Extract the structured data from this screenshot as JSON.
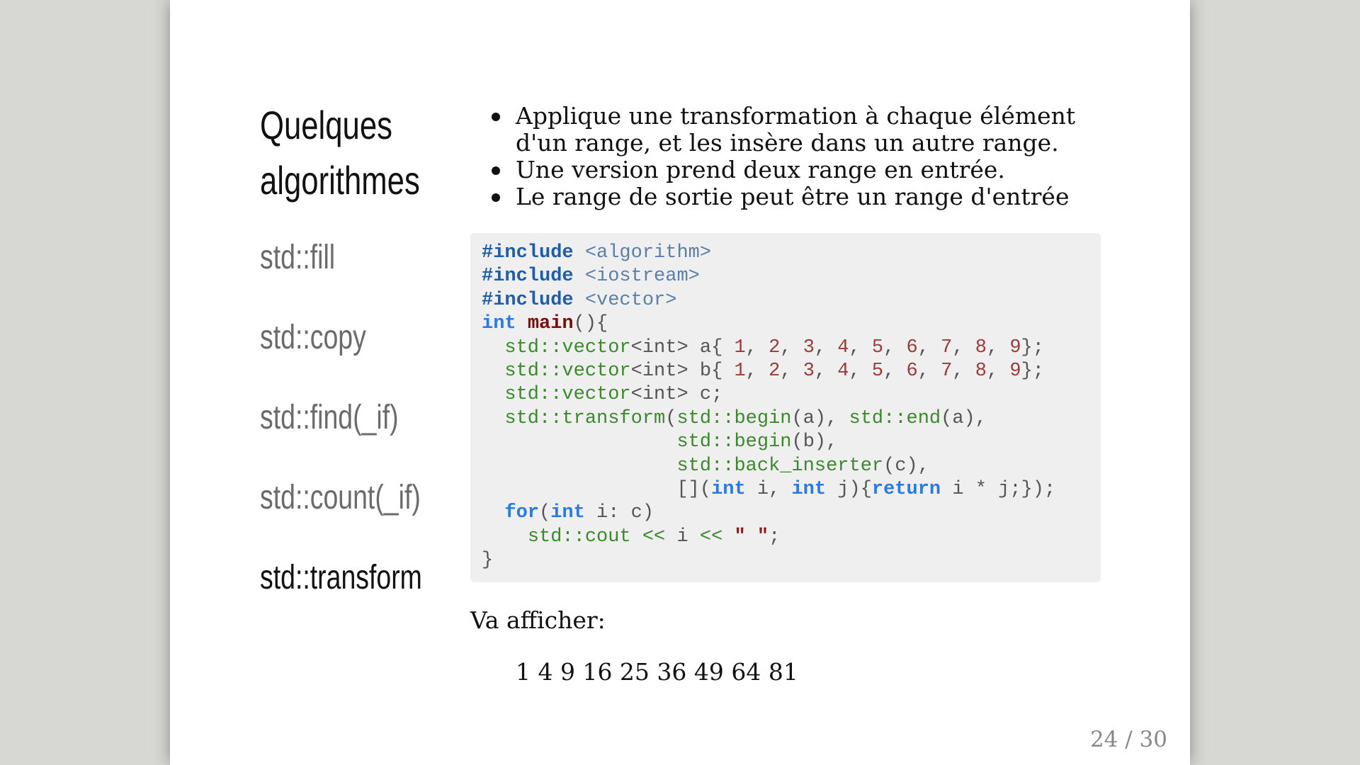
{
  "slide": {
    "title_line1": "Quelques",
    "title_line2": "algorithmes",
    "nav": [
      {
        "label": "std::fill",
        "active": false
      },
      {
        "label": "std::copy",
        "active": false
      },
      {
        "label": "std::find(_if)",
        "active": false
      },
      {
        "label": "std::count(_if)",
        "active": false
      },
      {
        "label": "std::transform",
        "active": true
      }
    ],
    "bullets": [
      "Applique une transformation à chaque élément d'un range, et les insère dans un autre range.",
      "Une version prend deux range en entrée.",
      "Le range de sortie peut être un range d'entrée"
    ],
    "code_lines": [
      "#include <algorithm>",
      "#include <iostream>",
      "#include <vector>",
      "int main(){",
      "  std::vector<int> a{ 1, 2, 3, 4, 5, 6, 7, 8, 9};",
      "  std::vector<int> b{ 1, 2, 3, 4, 5, 6, 7, 8, 9};",
      "  std::vector<int> c;",
      "  std::transform(std::begin(a), std::end(a),",
      "                 std::begin(b),",
      "                 std::back_inserter(c),",
      "                 [](int i, int j){return i * j;});",
      "  for(int i: c)",
      "    std::cout << i << \" \";",
      "}"
    ],
    "output_label": "Va afficher:",
    "output_value": "1 4 9 16 25 36 49 64 81",
    "page_number": "24 / 30"
  }
}
